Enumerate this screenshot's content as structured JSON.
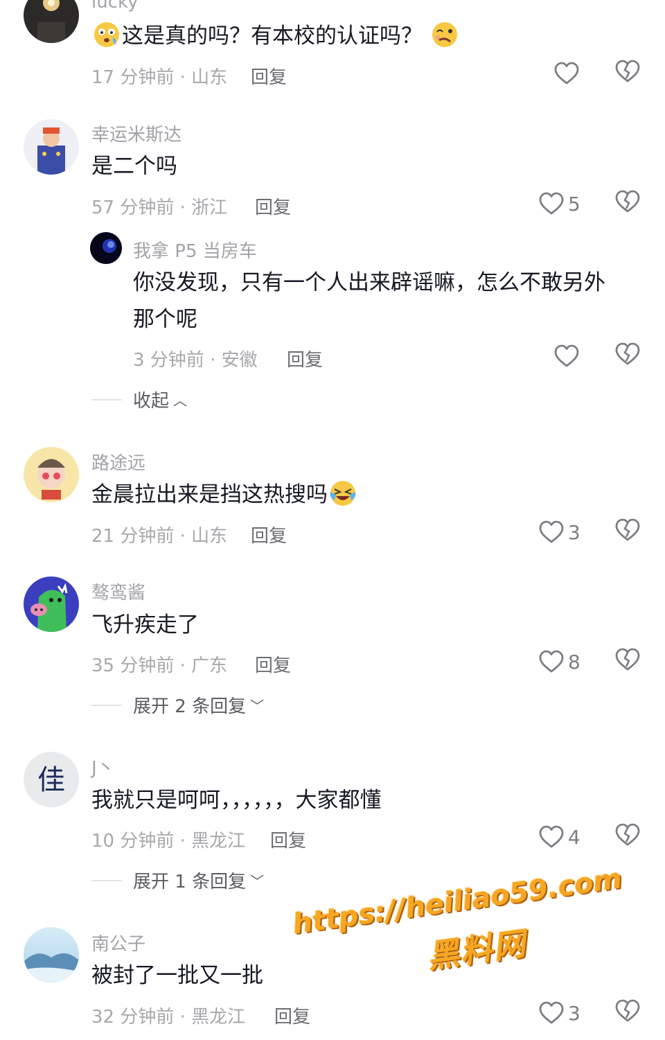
{
  "comments": [
    {
      "username": "lucky",
      "content": "这是真的吗？有本校的认证吗？",
      "meta": "17 分钟前 · 山东",
      "reply": "回复",
      "likes": ""
    },
    {
      "username": "幸运米斯达",
      "content": "是二个吗",
      "meta": "57 分钟前 · 浙江",
      "reply": "回复",
      "likes": "5",
      "sub_reply": {
        "username": "我拿 P5 当房车",
        "content_line1": "你没发现，只有一个人出来辟谣嘛，怎么不敢另外",
        "content_line2": "那个呢",
        "meta": "3 分钟前 · 安徽",
        "reply": "回复",
        "likes": ""
      },
      "collapse": "收起"
    },
    {
      "username": "路途远",
      "content": "金晨拉出来是挡这热搜吗",
      "meta": "21 分钟前 · 山东",
      "reply": "回复",
      "likes": "3"
    },
    {
      "username": "骜鸾酱",
      "content": "飞升疾走了",
      "meta": "35 分钟前 · 广东",
      "reply": "回复",
      "likes": "8",
      "expand": "展开 2 条回复"
    },
    {
      "username": "J丶",
      "content": "我就只是呵呵，，，，，，大家都懂",
      "meta": "10 分钟前 · 黑龙江",
      "reply": "回复",
      "likes": "4",
      "expand": "展开 1 条回复"
    },
    {
      "username": "南公子",
      "content": "被封了一批又一批",
      "meta": "32 分钟前 · 黑龙江",
      "reply": "回复",
      "likes": "3"
    }
  ],
  "watermark": {
    "url": "https://heiliao59.com",
    "name": "黑料网"
  },
  "colors": {
    "text": "#161823",
    "username": "#a2a3a8",
    "meta": "#a7a8ac",
    "watermark": "#f6a623"
  },
  "icons": [
    "heart-icon",
    "broken-heart-icon",
    "chevron-up-icon",
    "chevron-down-icon",
    "emoji-icon"
  ]
}
